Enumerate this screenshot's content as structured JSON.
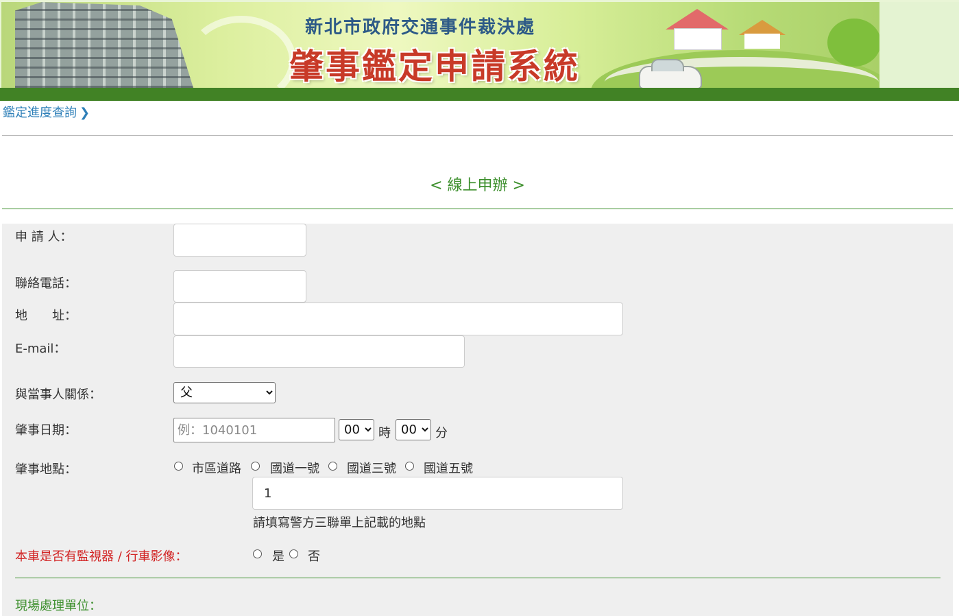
{
  "banner": {
    "agency": "新北市政府交通事件裁決處",
    "system_title": "肇事鑑定申請系統"
  },
  "nav": {
    "progress_link": "鑑定進度查詢",
    "chevron_icon": "chevron-right-icon"
  },
  "page": {
    "title": "< 線上申辦 >"
  },
  "form": {
    "applicant_label": "申 請 人：",
    "applicant_value": "",
    "phone_label": "聯絡電話：",
    "phone_value": "",
    "address_label": "地　　址：",
    "address_value": "",
    "email_label": "E-mail：",
    "email_value": "",
    "relation_label": "與當事人關係：",
    "relation_selected": "父",
    "date_label": "肇事日期：",
    "date_placeholder": "例：1040101",
    "hour_selected": "00",
    "hour_unit": "時",
    "minute_selected": "00",
    "minute_unit": "分",
    "location_label": "肇事地點：",
    "location_options": [
      "市區道路",
      "國道一號",
      "國道三號",
      "國道五號"
    ],
    "location_value": "1",
    "location_hint": "請填寫警方三聯單上記載的地點",
    "camera_label": "本車是否有監視器 / 行車影像：",
    "camera_options": [
      "是",
      "否"
    ],
    "unit_label": "現場處理單位："
  },
  "colors": {
    "brand_green": "#418225",
    "title_green": "#3c8f2c",
    "link_blue": "#2e7fb8",
    "warning_red": "#d22424",
    "form_bg": "#efefef"
  }
}
